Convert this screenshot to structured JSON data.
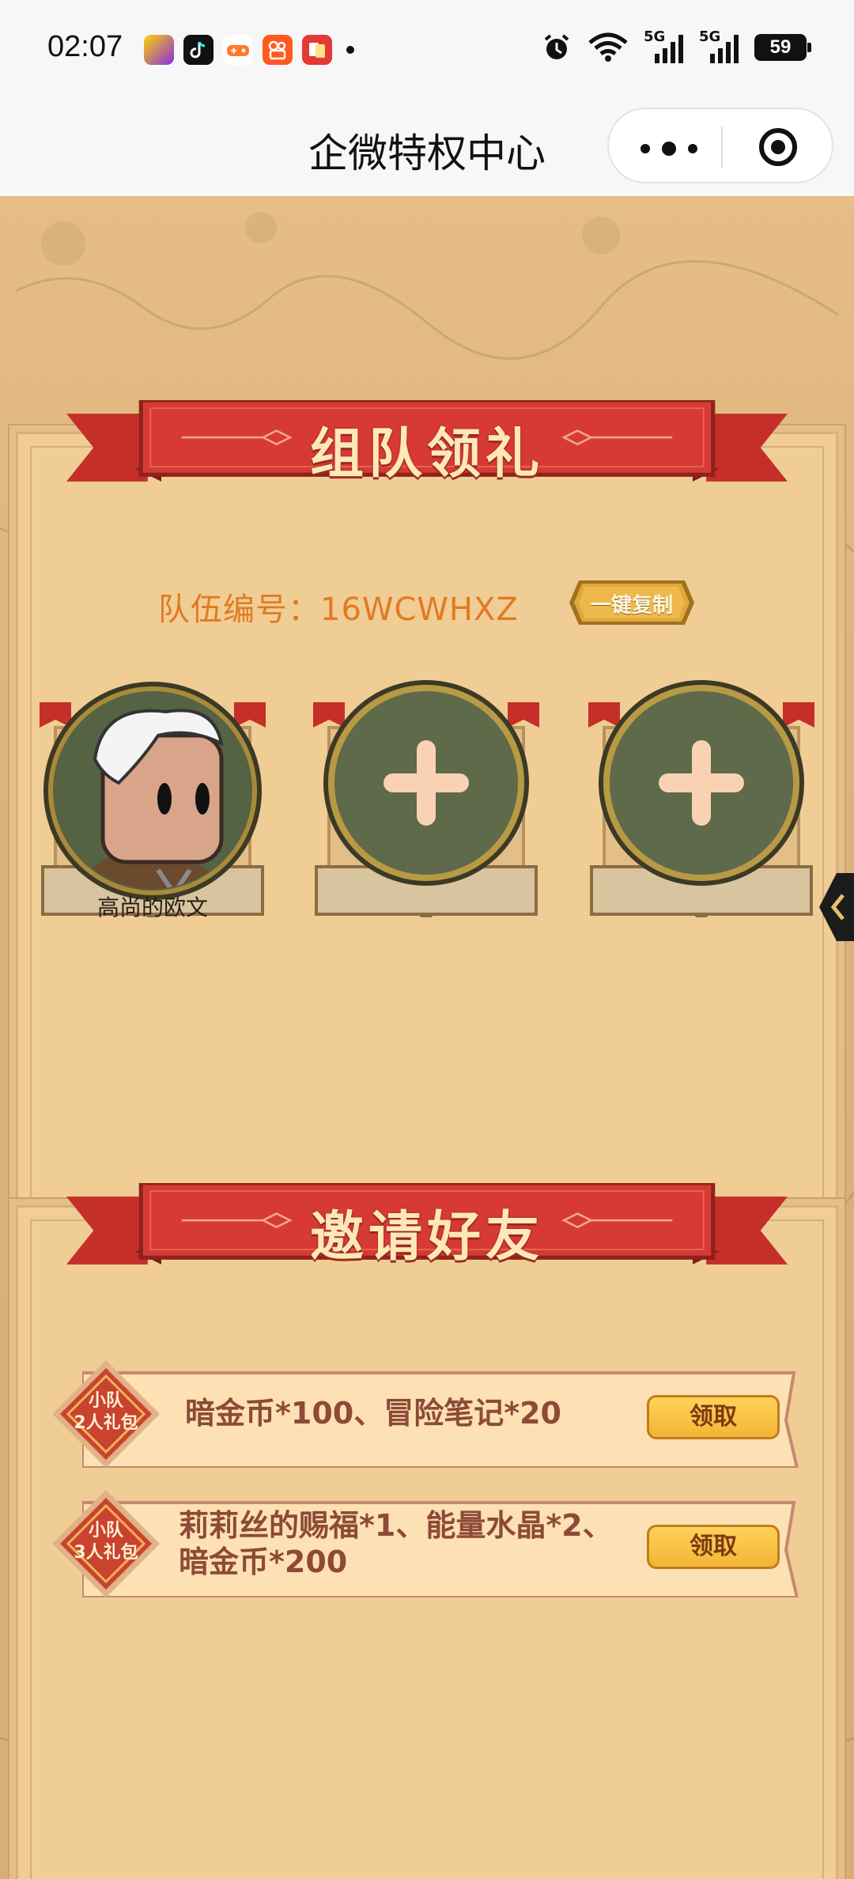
{
  "status_bar": {
    "time": "02:07",
    "battery": "59",
    "network_1": "5G",
    "network_2": "5G"
  },
  "nav": {
    "title": "企微特权中心"
  },
  "team": {
    "title": "组队领礼",
    "team_id_label": "队伍编号：16WCWHXZ",
    "copy_button": "一键复制",
    "members": [
      {
        "name": "高尚的欧文",
        "filled": true
      },
      {
        "name": "",
        "filled": false
      },
      {
        "name": "",
        "filled": false
      }
    ]
  },
  "invite": {
    "title": "邀请好友",
    "rewards": [
      {
        "badge_line1": "小队",
        "badge_line2": "2人礼包",
        "text_line1": "暗金币*100、冒险笔记*20",
        "text_line2": "",
        "button": "领取"
      },
      {
        "badge_line1": "小队",
        "badge_line2": "3人礼包",
        "text_line1": "莉莉丝的赐福*1、能量水晶*2、",
        "text_line2": "暗金币*200",
        "button": "领取"
      }
    ]
  },
  "colors": {
    "ribbon_red": "#d73a34",
    "panel_bg": "#f0cd94",
    "team_label": "#e07b22",
    "claim_button": "#f6c244",
    "slot_circle": "#5e6a4a"
  }
}
